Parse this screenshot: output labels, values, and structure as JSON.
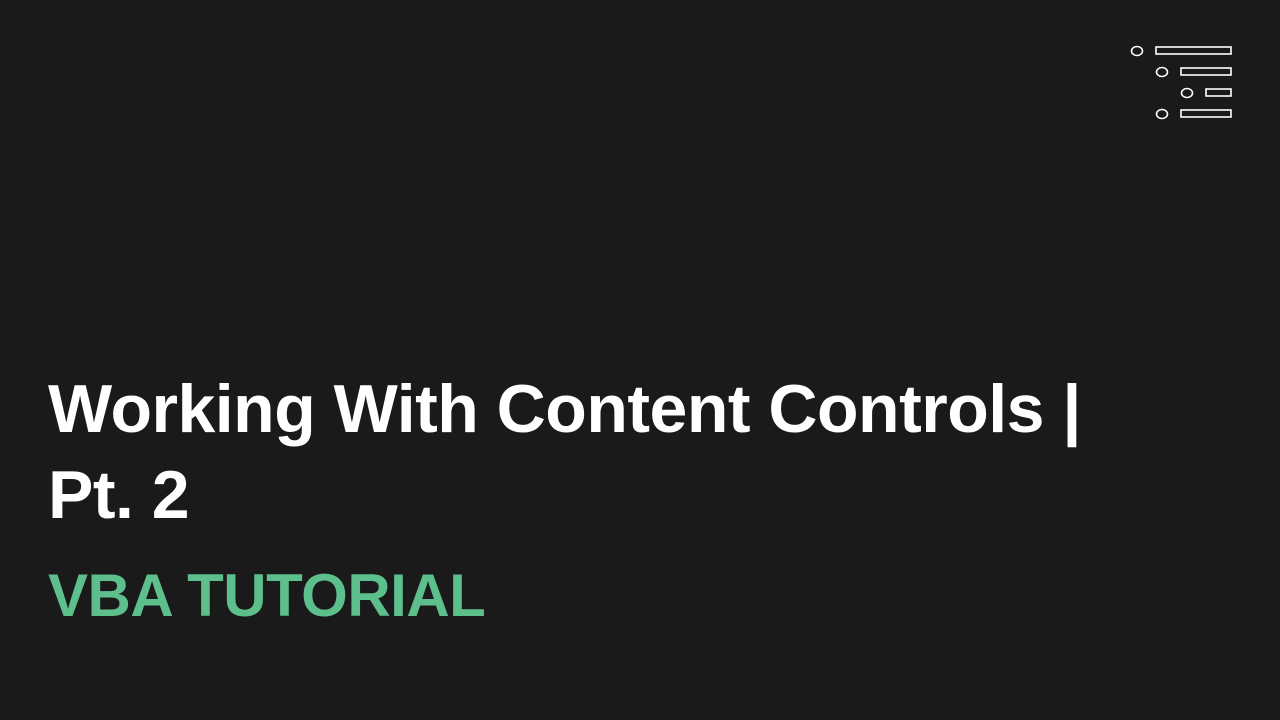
{
  "title_line1": "Working With Content Controls |",
  "title_line2": "Pt. 2",
  "subtitle": "VBA TUTORIAL",
  "logo_icon": "outline-list-icon",
  "colors": {
    "background": "#1b1a1b",
    "title": "#ffffff",
    "subtitle": "#5cbf8c",
    "logo": "#ffffff"
  }
}
